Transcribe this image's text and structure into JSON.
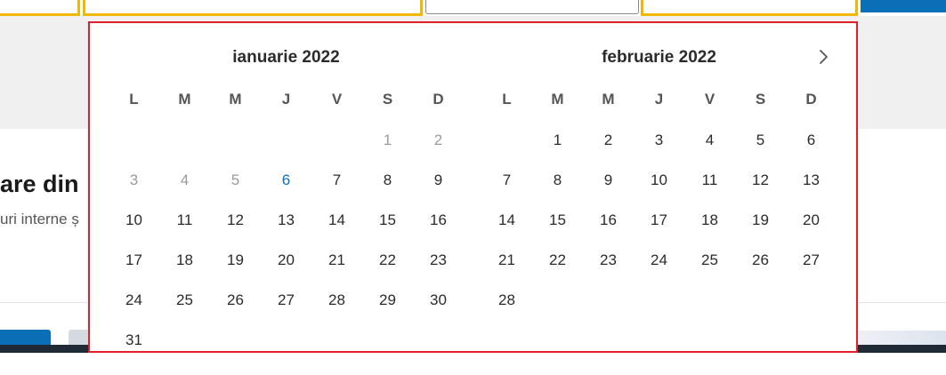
{
  "background": {
    "heading": "are din",
    "subtext": "uri interne ș"
  },
  "calendar": {
    "months": [
      {
        "title": "ianuarie 2022",
        "weekdays": [
          "L",
          "M",
          "M",
          "J",
          "V",
          "S",
          "D"
        ],
        "days": [
          {
            "label": "",
            "state": "empty"
          },
          {
            "label": "",
            "state": "empty"
          },
          {
            "label": "",
            "state": "empty"
          },
          {
            "label": "",
            "state": "empty"
          },
          {
            "label": "",
            "state": "empty"
          },
          {
            "label": "1",
            "state": "muted"
          },
          {
            "label": "2",
            "state": "muted"
          },
          {
            "label": "3",
            "state": "muted"
          },
          {
            "label": "4",
            "state": "muted"
          },
          {
            "label": "5",
            "state": "muted"
          },
          {
            "label": "6",
            "state": "today"
          },
          {
            "label": "7",
            "state": "normal"
          },
          {
            "label": "8",
            "state": "normal"
          },
          {
            "label": "9",
            "state": "normal"
          },
          {
            "label": "10",
            "state": "normal"
          },
          {
            "label": "11",
            "state": "normal"
          },
          {
            "label": "12",
            "state": "normal"
          },
          {
            "label": "13",
            "state": "normal"
          },
          {
            "label": "14",
            "state": "normal"
          },
          {
            "label": "15",
            "state": "normal"
          },
          {
            "label": "16",
            "state": "normal"
          },
          {
            "label": "17",
            "state": "normal"
          },
          {
            "label": "18",
            "state": "normal"
          },
          {
            "label": "19",
            "state": "normal"
          },
          {
            "label": "20",
            "state": "normal"
          },
          {
            "label": "21",
            "state": "normal"
          },
          {
            "label": "22",
            "state": "normal"
          },
          {
            "label": "23",
            "state": "normal"
          },
          {
            "label": "24",
            "state": "normal"
          },
          {
            "label": "25",
            "state": "normal"
          },
          {
            "label": "26",
            "state": "normal"
          },
          {
            "label": "27",
            "state": "normal"
          },
          {
            "label": "28",
            "state": "normal"
          },
          {
            "label": "29",
            "state": "normal"
          },
          {
            "label": "30",
            "state": "normal"
          },
          {
            "label": "31",
            "state": "normal"
          }
        ]
      },
      {
        "title": "februarie 2022",
        "weekdays": [
          "L",
          "M",
          "M",
          "J",
          "V",
          "S",
          "D"
        ],
        "days": [
          {
            "label": "",
            "state": "empty"
          },
          {
            "label": "1",
            "state": "normal"
          },
          {
            "label": "2",
            "state": "normal"
          },
          {
            "label": "3",
            "state": "normal"
          },
          {
            "label": "4",
            "state": "normal"
          },
          {
            "label": "5",
            "state": "normal"
          },
          {
            "label": "6",
            "state": "normal"
          },
          {
            "label": "7",
            "state": "normal"
          },
          {
            "label": "8",
            "state": "normal"
          },
          {
            "label": "9",
            "state": "normal"
          },
          {
            "label": "10",
            "state": "normal"
          },
          {
            "label": "11",
            "state": "normal"
          },
          {
            "label": "12",
            "state": "normal"
          },
          {
            "label": "13",
            "state": "normal"
          },
          {
            "label": "14",
            "state": "normal"
          },
          {
            "label": "15",
            "state": "normal"
          },
          {
            "label": "16",
            "state": "normal"
          },
          {
            "label": "17",
            "state": "normal"
          },
          {
            "label": "18",
            "state": "normal"
          },
          {
            "label": "19",
            "state": "normal"
          },
          {
            "label": "20",
            "state": "normal"
          },
          {
            "label": "21",
            "state": "normal"
          },
          {
            "label": "22",
            "state": "normal"
          },
          {
            "label": "23",
            "state": "normal"
          },
          {
            "label": "24",
            "state": "normal"
          },
          {
            "label": "25",
            "state": "normal"
          },
          {
            "label": "26",
            "state": "normal"
          },
          {
            "label": "27",
            "state": "normal"
          },
          {
            "label": "28",
            "state": "normal"
          }
        ]
      }
    ],
    "next_icon": "chevron-right-icon"
  },
  "colors": {
    "accent": "#0b6fb8",
    "highlight_border": "#e0202a",
    "input_border": "#f2b705",
    "muted_day": "#9a9a9a"
  }
}
